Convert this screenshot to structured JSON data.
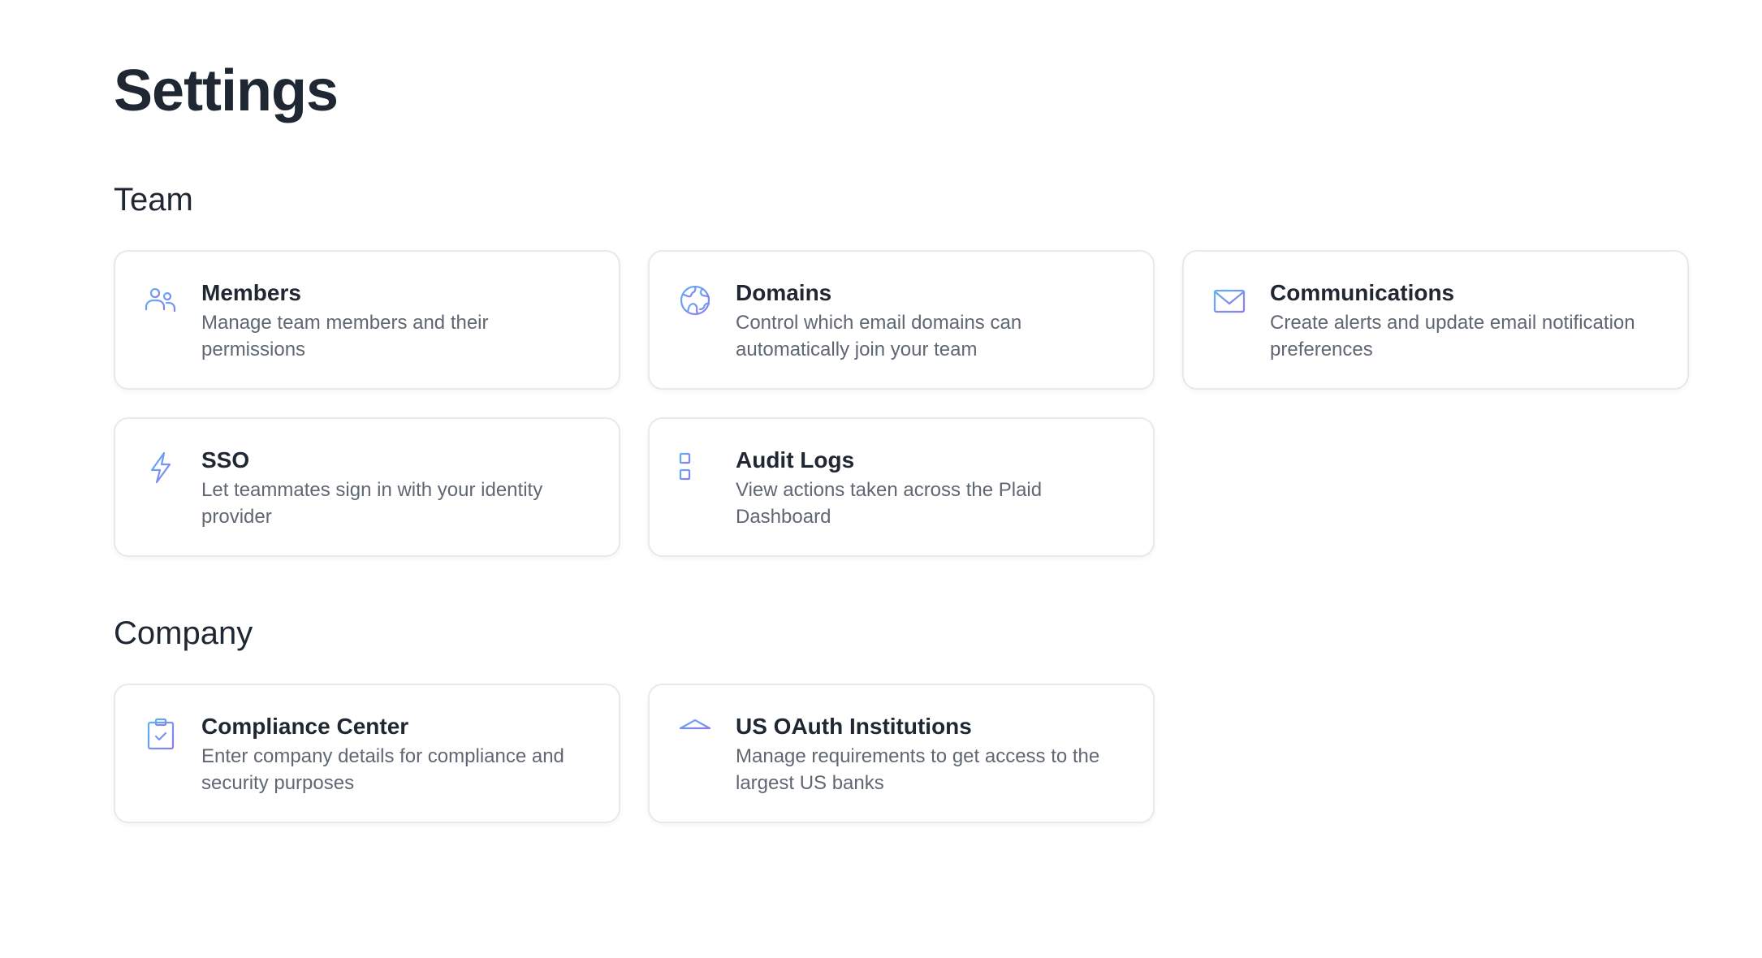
{
  "page": {
    "title": "Settings"
  },
  "colors": {
    "icon_gradient_start": "#5fb0f4",
    "icon_gradient_end": "#8b7cf0",
    "card_border": "#e6e9ee",
    "title_text": "#1f2733",
    "desc_text": "#5f6773"
  },
  "team": {
    "heading": "Team",
    "cards": [
      {
        "title": "Members",
        "description": "Manage team members and their permissions",
        "icon": "people-icon"
      },
      {
        "title": "Domains",
        "description": "Control which email domains can automatically join your team",
        "icon": "globe-icon"
      },
      {
        "title": "Communications",
        "description": "Create alerts and update email notification preferences",
        "icon": "envelope-icon"
      },
      {
        "title": "SSO",
        "description": "Let teammates sign in with your identity provider",
        "icon": "lightning-icon"
      },
      {
        "title": "Audit Logs",
        "description": "View actions taken across the Plaid Dashboard",
        "icon": "list-icon"
      }
    ]
  },
  "company": {
    "heading": "Company",
    "cards": [
      {
        "title": "Compliance Center",
        "description": "Enter company details for compliance and security purposes",
        "icon": "clipboard-check-icon"
      },
      {
        "title": "US OAuth Institutions",
        "description": "Manage requirements to get access to the largest US banks",
        "icon": "bank-icon"
      }
    ]
  }
}
